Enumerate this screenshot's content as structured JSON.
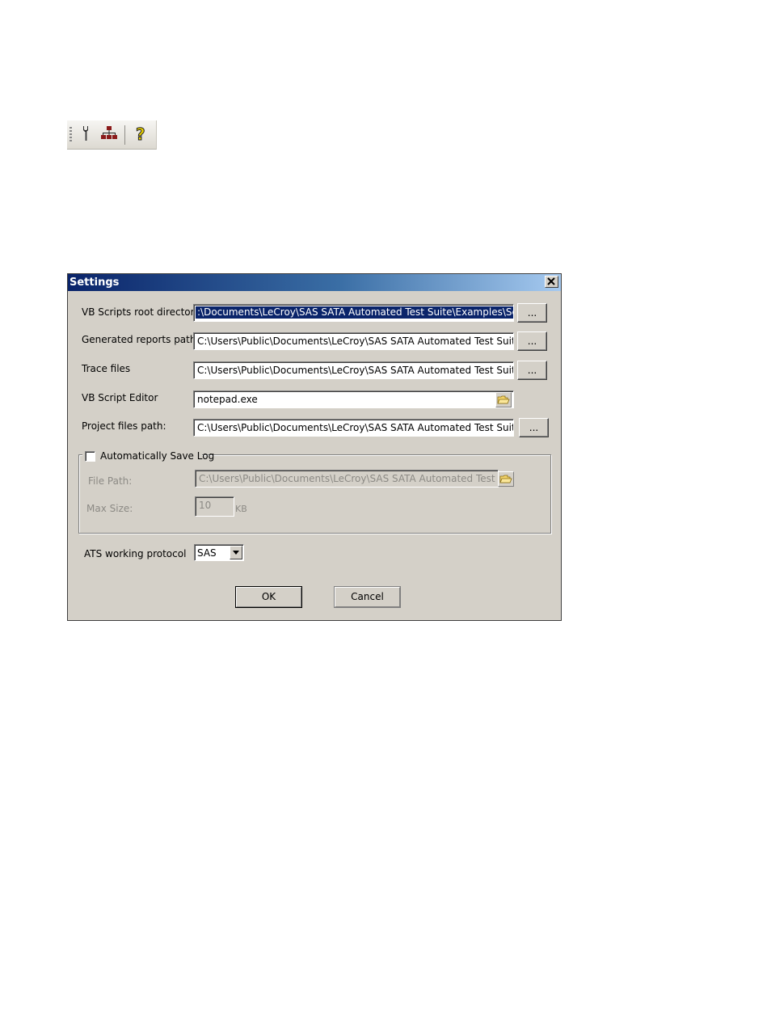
{
  "toolbar": {
    "icons": [
      "settings-wrench-icon",
      "hierarchy-tree-icon",
      "help-question-icon"
    ]
  },
  "dialog": {
    "title": "Settings",
    "fields": {
      "vb_scripts_root": {
        "label": "VB Scripts root directory",
        "value": ":\\Documents\\LeCroy\\SAS SATA Automated Test Suite\\Examples\\Scripts",
        "button": "..."
      },
      "reports_path": {
        "label": "Generated reports path :",
        "value": "C:\\Users\\Public\\Documents\\LeCroy\\SAS SATA Automated Test Suite\\Doc",
        "button": "..."
      },
      "trace_files": {
        "label": "Trace files",
        "value": "C:\\Users\\Public\\Documents\\LeCroy\\SAS SATA Automated Test Suite\\Out",
        "button": "..."
      },
      "script_editor": {
        "label": "VB Script Editor",
        "value": "notepad.exe"
      },
      "project_files": {
        "label": "Project files path:",
        "value": "C:\\Users\\Public\\Documents\\LeCroy\\SAS SATA Automated Test Suite\\Exa",
        "button": "..."
      }
    },
    "auto_save": {
      "checkbox_label": "Automatically Save Log",
      "checked": false,
      "file_path_label": "File Path:",
      "file_path_value": "C:\\Users\\Public\\Documents\\LeCroy\\SAS SATA Automated Test Suite",
      "max_size_label": "Max Size:",
      "max_size_value": "10",
      "max_size_unit": "KB"
    },
    "protocol": {
      "label": "ATS working protocol",
      "selected": "SAS"
    },
    "buttons": {
      "ok": "OK",
      "cancel": "Cancel"
    }
  }
}
